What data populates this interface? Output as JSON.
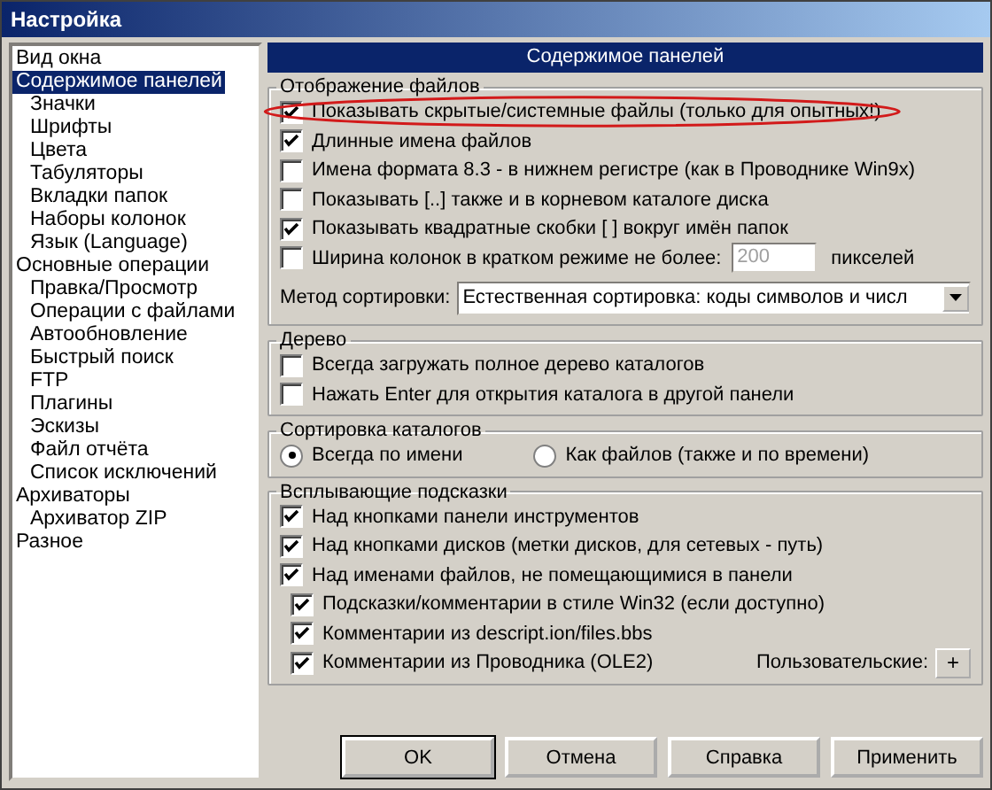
{
  "window": {
    "title": "Настройка"
  },
  "tree": [
    {
      "label": "Вид окна",
      "selected": false
    },
    {
      "label": "Содержимое панелей",
      "selected": true,
      "children": [
        {
          "label": "Значки",
          "selected": false
        },
        {
          "label": "Шрифты",
          "selected": false
        },
        {
          "label": "Цвета",
          "selected": false
        },
        {
          "label": "Табуляторы",
          "selected": false
        },
        {
          "label": "Вкладки папок",
          "selected": false
        },
        {
          "label": "Наборы колонок",
          "selected": false
        },
        {
          "label": "Язык (Language)",
          "selected": false
        }
      ]
    },
    {
      "label": "Основные операции",
      "selected": false,
      "children": [
        {
          "label": "Правка/Просмотр",
          "selected": false
        },
        {
          "label": "Операции с файлами",
          "selected": false
        },
        {
          "label": "Автообновление",
          "selected": false
        },
        {
          "label": "Быстрый поиск",
          "selected": false
        },
        {
          "label": "FTP",
          "selected": false
        },
        {
          "label": "Плагины",
          "selected": false
        },
        {
          "label": "Эскизы",
          "selected": false
        },
        {
          "label": "Файл отчёта",
          "selected": false
        },
        {
          "label": "Список исключений",
          "selected": false
        }
      ]
    },
    {
      "label": "Архиваторы",
      "selected": false,
      "children": [
        {
          "label": "Архиватор ZIP",
          "selected": false
        }
      ]
    },
    {
      "label": "Разное",
      "selected": false
    }
  ],
  "panel_title": "Содержимое панелей",
  "file_display": {
    "title": "Отображение файлов",
    "options": [
      {
        "kind": "check",
        "label": "Показывать скрытые/системные файлы (только для опытных!)",
        "checked": true,
        "highlighted": true
      },
      {
        "kind": "check",
        "label": "Длинные имена файлов",
        "checked": true
      },
      {
        "kind": "check",
        "label": "Имена формата 8.3 - в нижнем регистре (как в Проводнике Win9x)",
        "checked": false
      },
      {
        "kind": "check",
        "label": "Показывать [..] также и в корневом каталоге диска",
        "checked": false
      },
      {
        "kind": "check",
        "label": "Показывать квадратные скобки [ ] вокруг имён папок",
        "checked": true
      },
      {
        "kind": "width",
        "label": "Ширина колонок в кратком режиме не более:",
        "checked": false,
        "value": "200",
        "unit": "пикселей",
        "field_disabled": true
      }
    ],
    "sort_label": "Метод сортировки:",
    "sort_value": "Естественная сортировка: коды символов и числ"
  },
  "tree_group": {
    "title": "Дерево",
    "options": [
      {
        "label": "Всегда загружать полное дерево каталогов",
        "checked": false
      },
      {
        "label": "Нажать Enter для открытия каталога в другой панели",
        "checked": false
      }
    ]
  },
  "dir_sort": {
    "title": "Сортировка каталогов",
    "options": [
      {
        "label": "Всегда по имени",
        "selected": true
      },
      {
        "label": "Как файлов (также и по времени)",
        "selected": false
      }
    ]
  },
  "tooltips": {
    "title": "Всплывающие подсказки",
    "options": [
      {
        "kind": "check",
        "label": "Над кнопками панели инструментов",
        "checked": true
      },
      {
        "kind": "check",
        "label": "Над кнопками дисков (метки дисков, для сетевых - путь)",
        "checked": true
      },
      {
        "kind": "check",
        "label": "Над именами файлов, не помещающимися в панели",
        "checked": true
      },
      {
        "kind": "sub",
        "label": "Подсказки/комментарии в стиле Win32 (если доступно)",
        "checked": true
      },
      {
        "kind": "sub",
        "label": "Комментарии из descript.ion/files.bbs",
        "checked": true
      },
      {
        "kind": "sub",
        "label": "Комментарии из Проводника (OLE2)",
        "checked": true
      }
    ],
    "custom_label": "Пользовательские:",
    "custom_button": "+"
  },
  "buttons": [
    {
      "label": "OK",
      "default": true
    },
    {
      "label": "Отмена",
      "default": false
    },
    {
      "label": "Справка",
      "default": false
    },
    {
      "label": "Применить",
      "default": false
    }
  ]
}
